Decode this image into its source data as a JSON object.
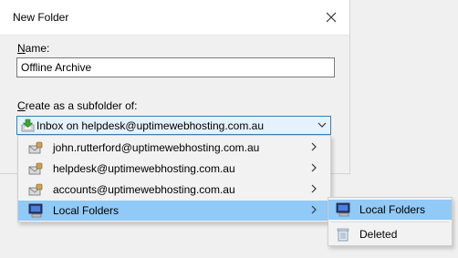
{
  "dialog": {
    "title": "New Folder",
    "name_label": "Name:",
    "name_value": "Offline Archive",
    "subfolder_label": "Create as a subfolder of:",
    "selected_parent": "Inbox on helpdesk@uptimewebhosting.com.au"
  },
  "menu": {
    "items": [
      {
        "label": "john.rutterford@uptimewebhosting.com.au",
        "icon": "mail-account-icon"
      },
      {
        "label": "helpdesk@uptimewebhosting.com.au",
        "icon": "mail-account-icon"
      },
      {
        "label": "accounts@uptimewebhosting.com.au",
        "icon": "mail-account-icon"
      },
      {
        "label": "Local Folders",
        "icon": "computer-icon"
      }
    ]
  },
  "submenu": {
    "items": [
      {
        "label": "Local Folders",
        "icon": "computer-icon"
      },
      {
        "label": "Deleted",
        "icon": "trash-icon"
      }
    ]
  },
  "colors": {
    "highlight": "#91c9f7",
    "combo_border": "#3c7fb1",
    "combo_bg": "#e5f1fb"
  }
}
